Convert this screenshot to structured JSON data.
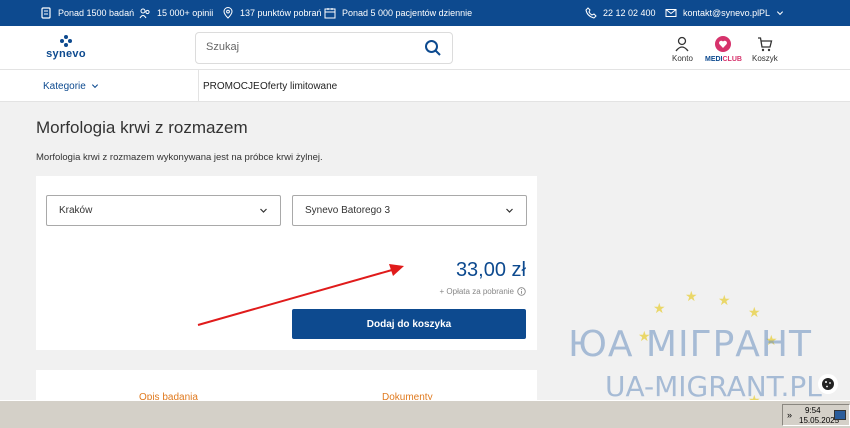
{
  "topbar": {
    "stats": [
      {
        "icon": "lab-icon",
        "text": "Ponad 1500 badań"
      },
      {
        "icon": "people-icon",
        "text": "15 000+ opinii"
      },
      {
        "icon": "location-pin-icon",
        "text": "137 punktów pobrań"
      },
      {
        "icon": "calendar-icon",
        "text": "Ponad 5 000 pacjentów dziennie"
      }
    ],
    "phone": "22 12 02 400",
    "email": "kontakt@synevo.pl",
    "language": "PL"
  },
  "header": {
    "logo_text": "synevo",
    "search_placeholder": "Szukaj",
    "account_label": "Konto",
    "mediclub_prefix": "MEDI",
    "mediclub_suffix": "CLUB",
    "cart_label": "Koszyk"
  },
  "nav": {
    "categories_label": "Kategorie",
    "links": [
      "PROMOCJE",
      "Oferty limitowane"
    ]
  },
  "main": {
    "title": "Morfologia krwi z rozmazem",
    "description": "Morfologia krwi z rozmazem wykonywana jest na próbce krwi żylnej.",
    "city_select": "Kraków",
    "location_select": "Synevo Batorego 3",
    "price": "33,00 zł",
    "fee_note": "+ Opłata za pobranie",
    "add_to_cart": "Dodaj do koszyka",
    "tabs": [
      "Opis badania",
      "Dokumenty"
    ]
  },
  "watermark": {
    "line1": "ЮА МІГРАНТ",
    "line2": "UA-MIGRANT.PL"
  },
  "taskbar": {
    "time": "9:54",
    "date": "15.05.2025"
  },
  "colors": {
    "brand": "#0d4a8f",
    "accent_tab": "#e07a1f",
    "arrow": "#e01b1b",
    "mediclub_heart": "#d6336c"
  }
}
